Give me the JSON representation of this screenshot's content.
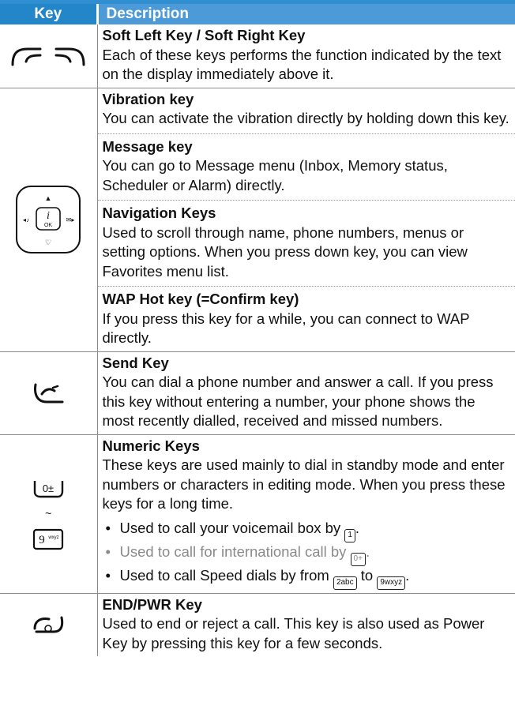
{
  "header": {
    "key": "Key",
    "description": "Description"
  },
  "rows": {
    "soft": {
      "icon": "soft-left-right-key-icons",
      "title": "Soft Left Key / Soft Right Key",
      "text": "Each of these keys performs the function indicated by the text on the display immediately above it."
    },
    "nav": {
      "icon": "navigation-pad-icon",
      "s0": {
        "title": "Vibration key",
        "text": "You can activate the vibration directly by holding down this key."
      },
      "s1": {
        "title": "Message key",
        "text": "You can go to Message menu (Inbox, Memory status, Scheduler or Alarm) directly."
      },
      "s2": {
        "title": "Navigation Keys",
        "text": "Used to scroll through name, phone numbers, menus or setting options. When you press down key, you can view Favorites menu list."
      },
      "s3": {
        "title": "WAP Hot key (=Confirm key)",
        "text": "If you press this key for a while, you can connect to WAP directly."
      }
    },
    "send": {
      "icon": "send-key-icon",
      "title": "Send Key",
      "text": "You can dial a phone number and answer a call. If you press this key without entering a number, your phone shows the most recently dialled, received and missed numbers."
    },
    "numeric": {
      "icon_top": "zero-key-icon",
      "range_mark": "~",
      "icon_bottom": "nine-key-icon",
      "title": "Numeric Keys",
      "text": "These keys are used mainly to dial in standby mode and enter numbers or characters in editing mode. When you press these keys for a long time.",
      "b0": "Used to call your voicemail box by",
      "b0_key": "1",
      "b1": "Used to call for international call by",
      "b1_key": "0+",
      "b2a": "Used to call Speed dials by from",
      "b2_key_from": "2abc",
      "b2_mid": "to",
      "b2_key_to": "9wxyz",
      "period": "."
    },
    "end": {
      "icon": "end-power-key-icon",
      "title": "END/PWR Key",
      "text": "Used to end or reject a call. This key is also used as Power Key by pressing this key for a few seconds."
    }
  },
  "colors": {
    "key_header": "#2386c9",
    "desc_header": "#4c9ad8"
  }
}
